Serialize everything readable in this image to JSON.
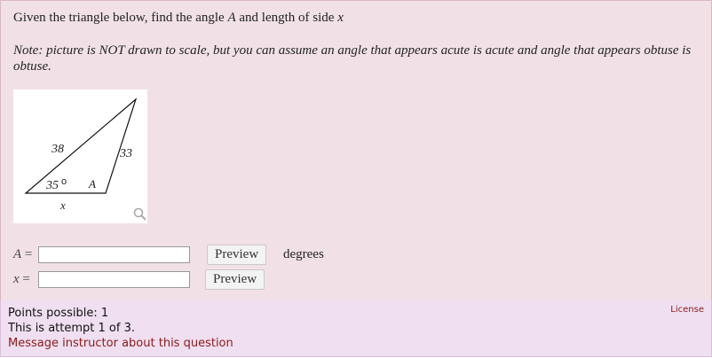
{
  "question": {
    "prompt_parts": [
      "Given the triangle below, find the angle ",
      "A",
      " and length of side ",
      "x"
    ],
    "note": "Note: picture is NOT drawn to scale, but you can assume an angle that appears acute is acute and angle that appears obtuse is obtuse.",
    "figure": {
      "side_left": "38",
      "side_right": "33",
      "angle_label": "35",
      "degree_symbol": "o",
      "vertex_label": "A",
      "bottom_label": "x",
      "zoom_icon": "magnifier-icon"
    },
    "inputs": [
      {
        "var": "A",
        "equals": "=",
        "value": "",
        "preview_label": "Preview",
        "units": "degrees"
      },
      {
        "var": "x",
        "equals": "=",
        "value": "",
        "preview_label": "Preview",
        "units": ""
      }
    ]
  },
  "footer": {
    "points": "Points possible: 1",
    "attempt": "This is attempt 1 of 3.",
    "message_link": "Message instructor about this question",
    "license_link": "License"
  },
  "colors": {
    "question_bg": "#f1e1e6",
    "footer_bg": "#efdff0",
    "link": "#8b1a1a"
  }
}
